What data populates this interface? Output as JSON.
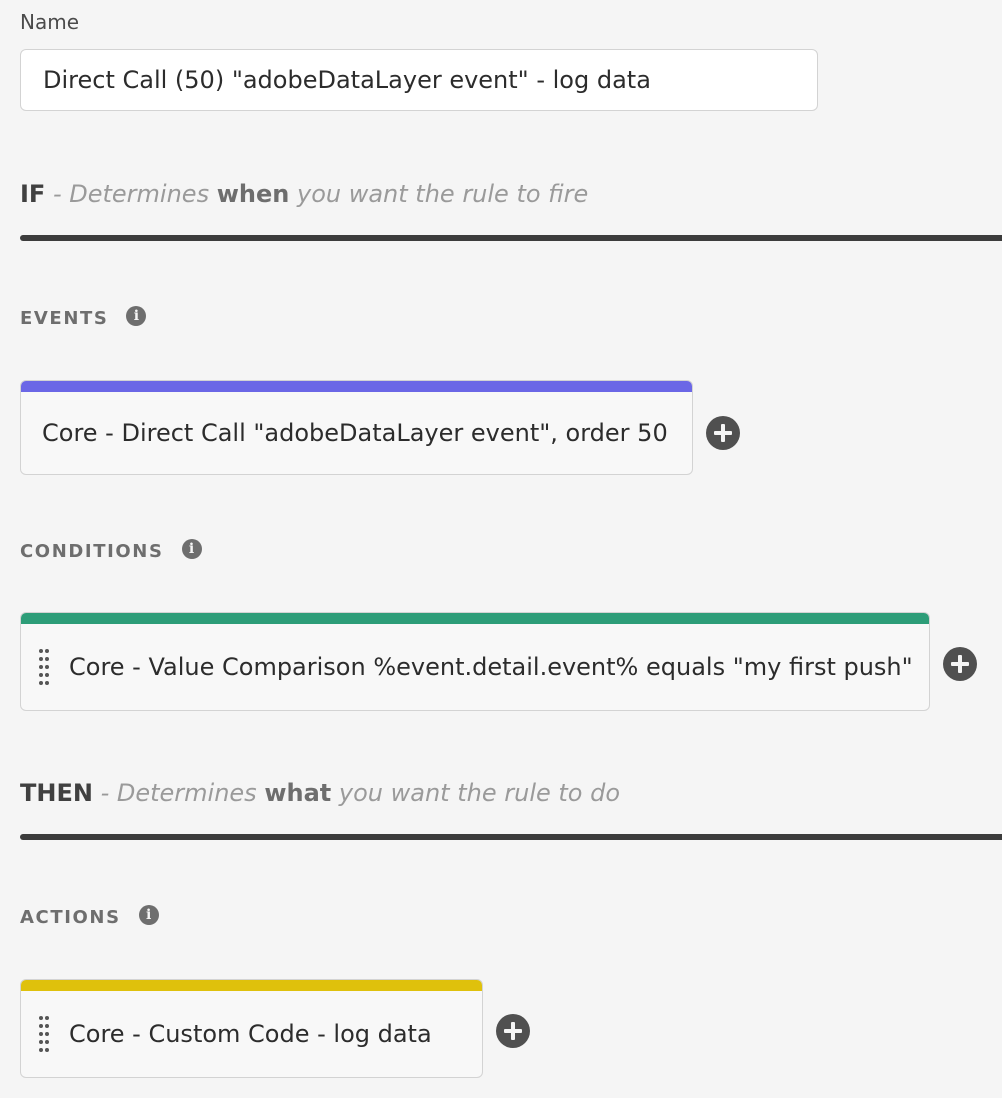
{
  "name_field": {
    "label": "Name",
    "value": "Direct Call (50) \"adobeDataLayer event\" - log data"
  },
  "if_section": {
    "keyword": "IF",
    "desc_prefix": "- Determines",
    "desc_bold": "when",
    "desc_suffix": "you want the rule to fire"
  },
  "events": {
    "label": "EVENTS",
    "info_icon": "info-icon",
    "items": [
      {
        "text": "Core - Direct Call \"adobeDataLayer event\", order 50",
        "accent": "#6b67e6"
      }
    ]
  },
  "conditions": {
    "label": "CONDITIONS",
    "info_icon": "info-icon",
    "items": [
      {
        "text": "Core - Value Comparison %event.detail.event% equals \"my first push\"",
        "accent": "#2d9d78"
      }
    ]
  },
  "then_section": {
    "keyword": "THEN",
    "desc_prefix": "- Determines",
    "desc_bold": "what",
    "desc_suffix": "you want the rule to do"
  },
  "actions": {
    "label": "ACTIONS",
    "info_icon": "info-icon",
    "items": [
      {
        "text": "Core - Custom Code - log data",
        "accent": "#dfc10c"
      }
    ]
  },
  "icons": {
    "add": "add-circle-icon",
    "drag": "drag-handle-icon",
    "info": "info-icon"
  }
}
